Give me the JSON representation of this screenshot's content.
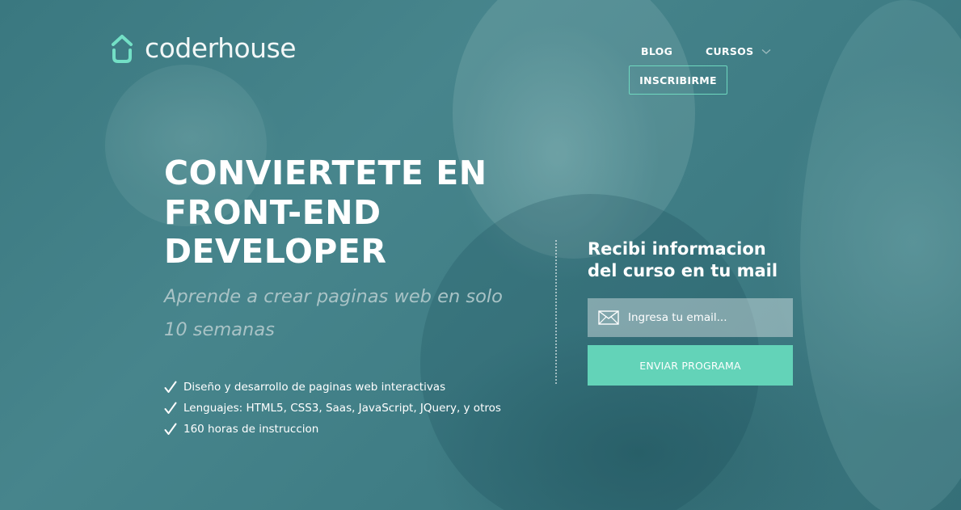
{
  "brand": {
    "name": "coderhouse",
    "icon": "house-logo-icon",
    "accent": "#63d3b8"
  },
  "nav": {
    "blog": "BLOG",
    "cursos": "CURSOS",
    "cursos_icon": "chevron-down-icon",
    "inscribirme": "INSCRIBIRME"
  },
  "hero": {
    "title_lines": [
      "CONVIERTETE EN",
      "FRONT-END",
      "DEVELOPER"
    ],
    "subtitle": "Aprende a crear paginas web en solo 10 semanas",
    "features": [
      "Diseño y desarrollo de paginas web interactivas",
      "Lenguajes: HTML5, CSS3, Saas, JavaScript, JQuery, y otros",
      "160 horas de instruccion"
    ]
  },
  "form": {
    "title": "Recibi informacion del curso en tu mail",
    "email_placeholder": "Ingresa tu email...",
    "email_value": "",
    "email_icon": "envelope-icon",
    "submit_label": "ENVIAR PROGRAMA"
  }
}
